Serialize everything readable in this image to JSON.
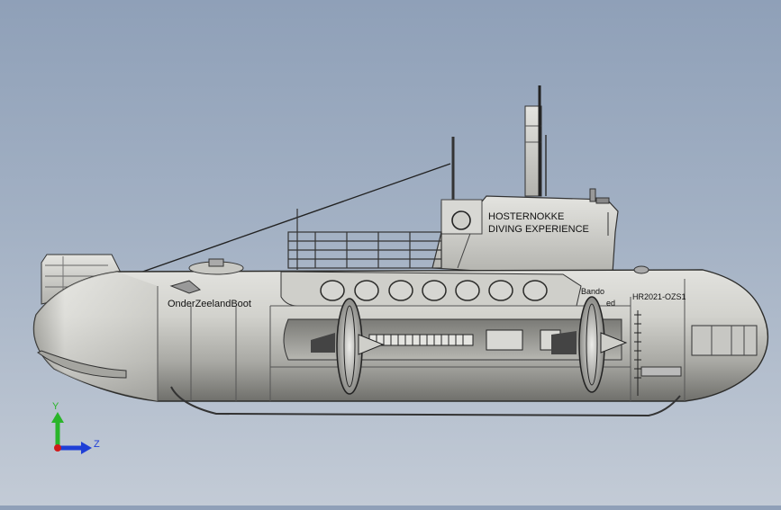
{
  "model": {
    "tower_line1": "HOSTERNOKKE",
    "tower_line2": "DIVING EXPERIENCE",
    "hull_name": "OnderZeelandBoot",
    "registration": "HR2021-OZS1",
    "side_text_1": "Bando",
    "side_text_2": "ed"
  },
  "triad": {
    "y_label": "Y",
    "z_label": "Z",
    "colors": {
      "y": "#2ab52a",
      "z": "#1f3fd6",
      "origin": "#d11a1a"
    }
  },
  "colors": {
    "background_top": "#8fa0b8",
    "background_bottom": "#c3cbd6",
    "hull": "#c9c9c5"
  }
}
